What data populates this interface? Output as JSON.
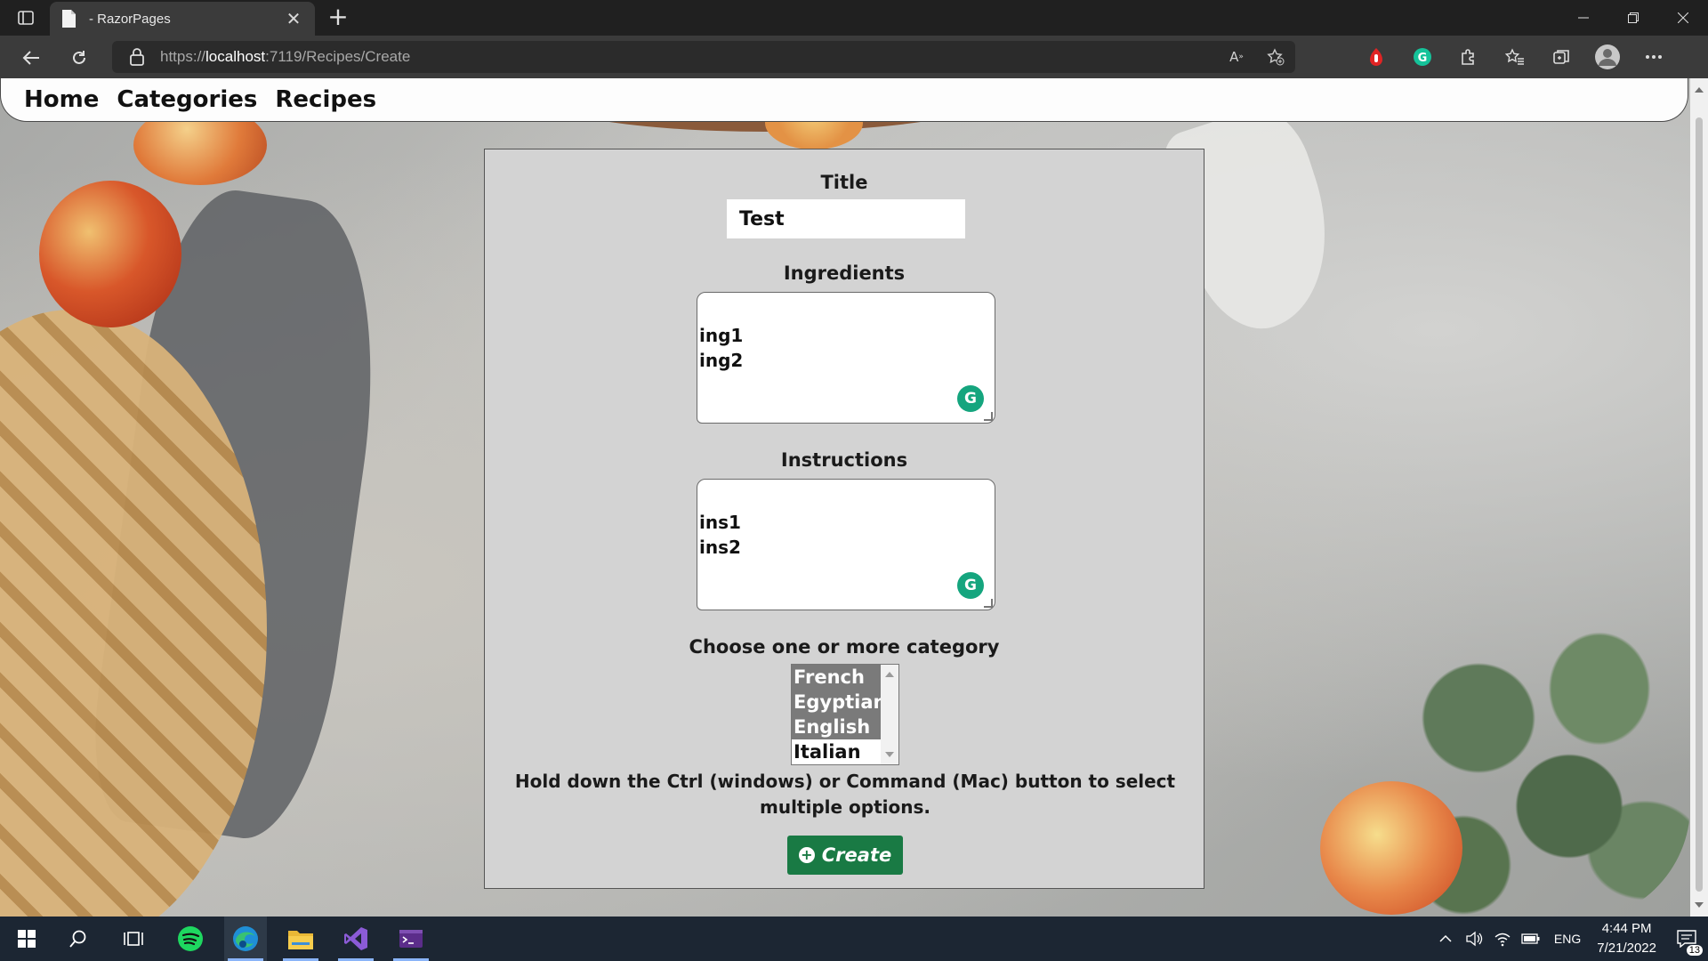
{
  "browser": {
    "tab_title": "- RazorPages",
    "url_prefix": "https://",
    "url_host": "localhost",
    "url_rest": ":7119/Recipes/Create",
    "new_tab_symbol": "+",
    "close_symbol": "✕"
  },
  "nav": {
    "links": [
      "Home",
      "Categories",
      "Recipes"
    ]
  },
  "form": {
    "title_label": "Title",
    "title_value": "Test",
    "ingredients_label": "Ingredients",
    "ingredients_value": "ing1\ning2",
    "instructions_label": "Instructions",
    "instructions_value": "ins1\nins2",
    "category_label": "Choose one or more category",
    "categories": [
      {
        "name": "French",
        "selected": true
      },
      {
        "name": "Egyptian",
        "selected": true
      },
      {
        "name": "English",
        "selected": true
      },
      {
        "name": "Italian",
        "selected": false
      }
    ],
    "hint": "Hold down the Ctrl (windows) or Command (Mac) button to select multiple options.",
    "create_label": "Create",
    "grammarly_symbol": "G"
  },
  "taskbar": {
    "language": "ENG",
    "time": "4:44 PM",
    "date": "7/21/2022",
    "notifications": "13"
  },
  "colors": {
    "create_button": "#197a44",
    "grammarly": "#15a57e",
    "form_bg": "#d3d3d3"
  }
}
